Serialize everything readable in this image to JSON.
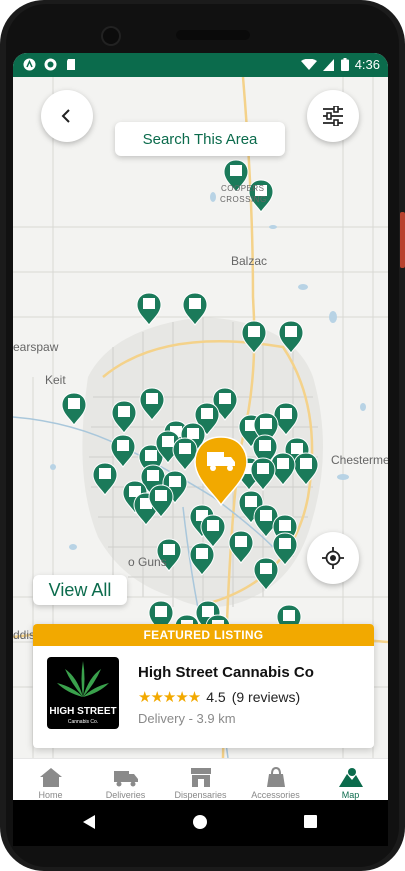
{
  "status": {
    "time": "4:36"
  },
  "top": {
    "search_label": "Search This Area"
  },
  "map": {
    "labels": [
      {
        "text": "COOPERS",
        "key": "coopers"
      },
      {
        "text": "CROSSING",
        "key": "crossing"
      },
      {
        "text": "Balzac",
        "key": "balzac"
      },
      {
        "text": "earspaw",
        "key": "bearspaw"
      },
      {
        "text": "Keit",
        "key": "keith"
      },
      {
        "text": "Chesterme",
        "key": "chestermere"
      },
      {
        "text": "o Guns",
        "key": "guns"
      },
      {
        "text": "ddis",
        "key": "addis"
      }
    ],
    "view_all_label": "View All"
  },
  "featured": {
    "banner": "FEATURED LISTING",
    "name": "High Street Cannabis Co",
    "rating": "4.5",
    "reviews": "(9 reviews)",
    "stars_display": "★★★★★",
    "subtitle": "Delivery - 3.9 km",
    "logo_text": "HIGH STREET",
    "logo_sub": "Cannabis Co."
  },
  "nav": {
    "items": [
      {
        "label": "Home",
        "icon": "home-icon"
      },
      {
        "label": "Deliveries",
        "icon": "truck-icon"
      },
      {
        "label": "Dispensaries",
        "icon": "storefront-icon"
      },
      {
        "label": "Accessories",
        "icon": "bag-icon"
      },
      {
        "label": "Map",
        "icon": "map-icon"
      }
    ]
  },
  "colors": {
    "brand_green": "#0b6b4c",
    "featured_orange": "#f2a900",
    "marker_green": "#1b7a5a"
  }
}
